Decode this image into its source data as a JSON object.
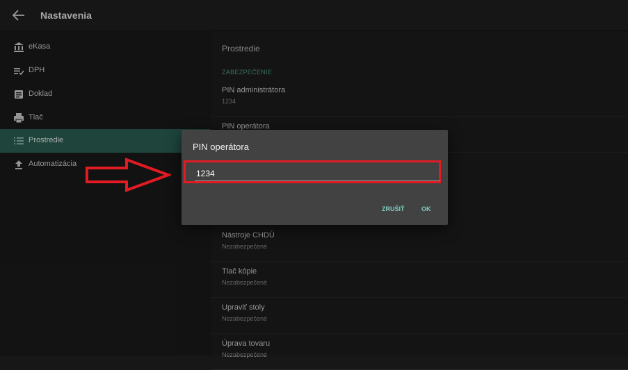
{
  "appbar": {
    "title": "Nastavenia",
    "back_icon": "arrow-left-icon"
  },
  "sidebar": {
    "items": [
      {
        "label": "eKasa",
        "icon": "bank-icon",
        "active": false
      },
      {
        "label": "DPH",
        "icon": "list-check-icon",
        "active": false
      },
      {
        "label": "Doklad",
        "icon": "document-icon",
        "active": false
      },
      {
        "label": "Tlač",
        "icon": "printer-icon",
        "active": false
      },
      {
        "label": "Prostredie",
        "icon": "list-icon",
        "active": true
      },
      {
        "label": "Automatizácia",
        "icon": "upload-icon",
        "active": false
      }
    ]
  },
  "content": {
    "title": "Prostredie",
    "section_header": "ZABEZPEČENIE",
    "prefs": [
      {
        "title": "PIN administrátora",
        "summary": "1234"
      },
      {
        "title": "PIN operátora",
        "summary": ""
      },
      {
        "title": "Nástroje CHDÚ",
        "summary": "Nezabezpečené"
      },
      {
        "title": "Tlač kópie",
        "summary": "Nezabezpečené"
      },
      {
        "title": "Upraviť stoly",
        "summary": "Nezabezpečené"
      },
      {
        "title": "Úprava tovaru",
        "summary": "Nezabezpečené"
      }
    ]
  },
  "dialog": {
    "title": "PIN operátora",
    "input_value": "1234",
    "cancel_label": "ZRUŠIŤ",
    "ok_label": "OK"
  },
  "colors": {
    "accent": "#4f9b8a",
    "active_item": "#2a5f52",
    "highlight": "#e21b23",
    "button_text": "#80cbc4"
  }
}
